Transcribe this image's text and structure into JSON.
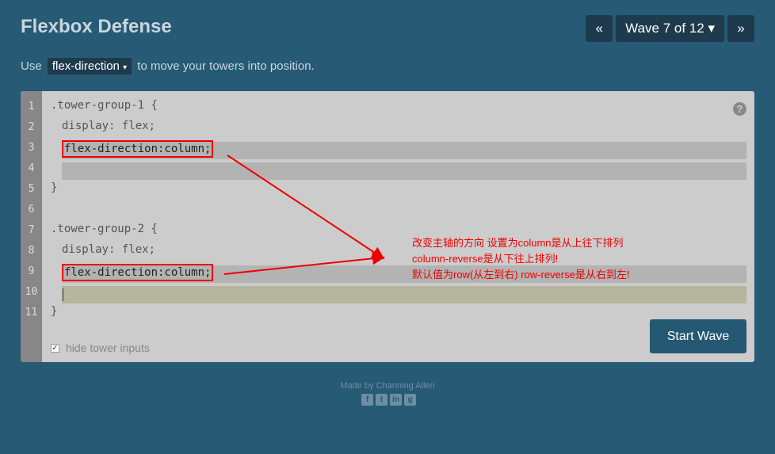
{
  "title": "Flexbox Defense",
  "nav": {
    "prev": "«",
    "wave": "Wave 7 of 12",
    "caret": "▾",
    "next": "»"
  },
  "instruction": {
    "before": "Use",
    "property": "flex-direction",
    "caret": "▾",
    "after": "to move your towers into position."
  },
  "editor": {
    "line_numbers": [
      "1",
      "2",
      "3",
      "4",
      "5",
      "6",
      "7",
      "8",
      "9",
      "10",
      "11"
    ],
    "lines": [
      ".tower-group-1 {",
      "display: flex;",
      "",
      "",
      "}",
      "",
      ".tower-group-2 {",
      "display: flex;",
      "",
      "",
      "}"
    ],
    "input_1": "flex-direction:column;",
    "input_2": "flex-direction:column;",
    "help": "?",
    "hide_inputs_label": "hide tower inputs",
    "hide_inputs_checked": true,
    "start_button": "Start Wave"
  },
  "annotation": {
    "line1": "改变主轴的方向 设置为column是从上往下排列",
    "line2": "column-reverse是从下往上排列!",
    "line3": "默认值为row(从左到右) row-reverse是从右到左!",
    "color": "#ee0000"
  },
  "footer": {
    "credit": "Made by Channing Allen",
    "icons": [
      "facebook-icon",
      "twitter-icon",
      "linkedin-icon",
      "github-icon"
    ]
  }
}
